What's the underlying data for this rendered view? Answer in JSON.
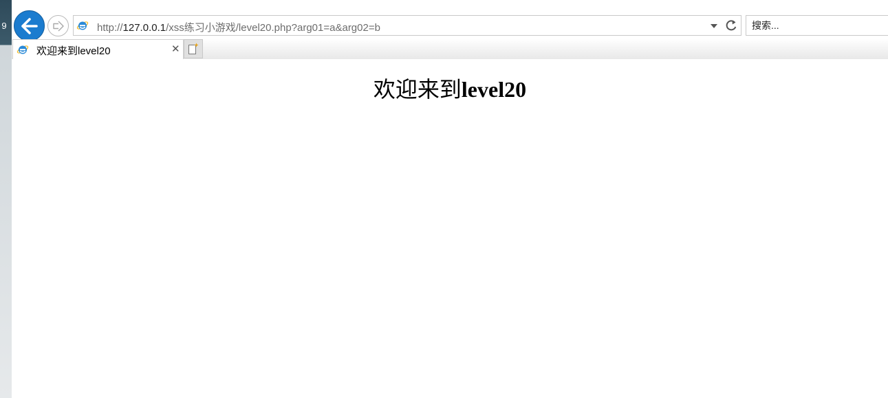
{
  "taskbar": {
    "badge": "9"
  },
  "browser": {
    "address": {
      "scheme": "http://",
      "host": "127.0.0.1",
      "path": "/xss练习小游戏/level20.php?arg01=a&arg02=b"
    },
    "search": {
      "placeholder": "搜索..."
    },
    "tabs": [
      {
        "title": "欢迎来到level20",
        "active": true
      }
    ]
  },
  "page": {
    "heading_prefix": "欢迎来到",
    "heading_bold": "level20"
  },
  "colors": {
    "back_button": "#1b7ccf",
    "ie_logo": "#2a8ad8"
  },
  "icons": {
    "back": "back-arrow-icon",
    "forward": "forward-arrow-icon",
    "ie": "internet-explorer-icon",
    "refresh": "refresh-icon",
    "dropdown": "chevron-down-icon",
    "close": "close-icon",
    "new_tab": "new-tab-icon"
  }
}
